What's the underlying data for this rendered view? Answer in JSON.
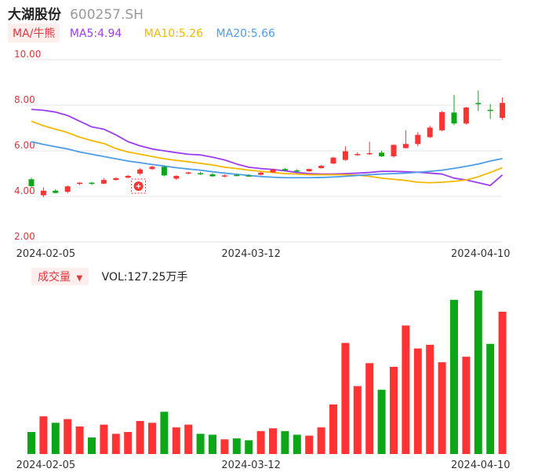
{
  "header": {
    "name": "大湖股份",
    "code": "600257.SH"
  },
  "ma_bar": {
    "button": "MA/牛熊",
    "items": [
      {
        "label": "MA5:4.94",
        "color": "#9b3ef2"
      },
      {
        "label": "MA10:5.26",
        "color": "#f5b800"
      },
      {
        "label": "MA20:5.66",
        "color": "#4d9de8"
      }
    ]
  },
  "vol_bar": {
    "button": "成交量",
    "value": "VOL:127.25万手"
  },
  "colors": {
    "up": "#ff3333",
    "down": "#0da619",
    "accent": "#e0353b"
  },
  "chart_data": {
    "type": "candlestick",
    "price_axis": {
      "ticks": [
        "10.00",
        "8.00",
        "6.00",
        "4.00",
        "2.00"
      ],
      "ylim": [
        2,
        10
      ]
    },
    "date_ticks": [
      {
        "label": "2024-02-05",
        "index": 1
      },
      {
        "label": "2024-03-12",
        "index": 18
      },
      {
        "label": "2024-04-10",
        "index": 37
      }
    ],
    "candles": [
      {
        "o": 4.75,
        "h": 4.82,
        "l": 4.42,
        "c": 4.45
      },
      {
        "o": 4.05,
        "h": 4.4,
        "l": 3.96,
        "c": 4.25
      },
      {
        "o": 4.25,
        "h": 4.32,
        "l": 4.14,
        "c": 4.15
      },
      {
        "o": 4.2,
        "h": 4.48,
        "l": 4.14,
        "c": 4.44
      },
      {
        "o": 4.55,
        "h": 4.62,
        "l": 4.5,
        "c": 4.6
      },
      {
        "o": 4.6,
        "h": 4.64,
        "l": 4.5,
        "c": 4.58
      },
      {
        "o": 4.56,
        "h": 4.8,
        "l": 4.54,
        "c": 4.72
      },
      {
        "o": 4.72,
        "h": 4.84,
        "l": 4.7,
        "c": 4.8
      },
      {
        "o": 4.82,
        "h": 4.94,
        "l": 4.8,
        "c": 4.9
      },
      {
        "o": 5.0,
        "h": 5.24,
        "l": 4.94,
        "c": 5.18
      },
      {
        "o": 5.2,
        "h": 5.35,
        "l": 5.16,
        "c": 5.3
      },
      {
        "o": 5.3,
        "h": 5.35,
        "l": 4.88,
        "c": 4.92
      },
      {
        "o": 4.78,
        "h": 4.92,
        "l": 4.72,
        "c": 4.9
      },
      {
        "o": 5.0,
        "h": 5.08,
        "l": 4.97,
        "c": 5.05
      },
      {
        "o": 5.02,
        "h": 5.08,
        "l": 4.94,
        "c": 4.97
      },
      {
        "o": 4.97,
        "h": 5.02,
        "l": 4.86,
        "c": 4.88
      },
      {
        "o": 4.88,
        "h": 4.96,
        "l": 4.84,
        "c": 4.92
      },
      {
        "o": 4.94,
        "h": 4.98,
        "l": 4.9,
        "c": 4.92
      },
      {
        "o": 4.92,
        "h": 4.97,
        "l": 4.86,
        "c": 4.9
      },
      {
        "o": 4.95,
        "h": 5.07,
        "l": 4.92,
        "c": 5.04
      },
      {
        "o": 5.06,
        "h": 5.22,
        "l": 5.03,
        "c": 5.18
      },
      {
        "o": 5.2,
        "h": 5.25,
        "l": 5.1,
        "c": 5.14
      },
      {
        "o": 5.14,
        "h": 5.2,
        "l": 5.06,
        "c": 5.12
      },
      {
        "o": 5.1,
        "h": 5.22,
        "l": 5.08,
        "c": 5.2
      },
      {
        "o": 5.24,
        "h": 5.38,
        "l": 5.22,
        "c": 5.34
      },
      {
        "o": 5.44,
        "h": 5.74,
        "l": 5.42,
        "c": 5.7
      },
      {
        "o": 5.6,
        "h": 6.2,
        "l": 5.56,
        "c": 5.98
      },
      {
        "o": 5.85,
        "h": 5.94,
        "l": 5.78,
        "c": 5.86
      },
      {
        "o": 5.86,
        "h": 6.4,
        "l": 5.82,
        "c": 5.9
      },
      {
        "o": 5.92,
        "h": 6.0,
        "l": 5.72,
        "c": 5.76
      },
      {
        "o": 5.76,
        "h": 6.28,
        "l": 5.7,
        "c": 6.26
      },
      {
        "o": 6.12,
        "h": 6.9,
        "l": 6.1,
        "c": 6.3
      },
      {
        "o": 6.3,
        "h": 6.82,
        "l": 6.2,
        "c": 6.7
      },
      {
        "o": 6.6,
        "h": 7.1,
        "l": 6.56,
        "c": 7.02
      },
      {
        "o": 6.9,
        "h": 7.75,
        "l": 6.85,
        "c": 7.7
      },
      {
        "o": 7.68,
        "h": 8.45,
        "l": 7.12,
        "c": 7.2
      },
      {
        "o": 7.2,
        "h": 7.93,
        "l": 7.15,
        "c": 7.9
      },
      {
        "o": 8.1,
        "h": 8.65,
        "l": 7.75,
        "c": 8.05
      },
      {
        "o": 7.8,
        "h": 8.05,
        "l": 7.4,
        "c": 7.75
      },
      {
        "o": 7.45,
        "h": 8.35,
        "l": 7.35,
        "c": 8.1
      }
    ],
    "ma5": [
      7.82,
      7.78,
      7.7,
      7.55,
      7.3,
      7.05,
      6.95,
      6.7,
      6.4,
      6.22,
      6.08,
      6.0,
      5.92,
      5.85,
      5.82,
      5.72,
      5.6,
      5.42,
      5.28,
      5.22,
      5.18,
      5.12,
      5.05,
      5.0,
      4.98,
      4.98,
      5.0,
      5.02,
      5.05,
      5.1,
      5.1,
      5.08,
      5.06,
      5.02,
      4.98,
      4.8,
      4.72,
      4.6,
      4.48,
      4.94
    ],
    "ma10": [
      7.3,
      7.1,
      6.95,
      6.8,
      6.6,
      6.45,
      6.32,
      6.1,
      5.95,
      5.85,
      5.75,
      5.65,
      5.58,
      5.52,
      5.45,
      5.38,
      5.28,
      5.22,
      5.15,
      5.1,
      5.05,
      5.0,
      4.98,
      4.95,
      4.95,
      4.95,
      4.95,
      4.93,
      4.88,
      4.8,
      4.75,
      4.7,
      4.62,
      4.6,
      4.62,
      4.66,
      4.72,
      4.86,
      5.05,
      5.26
    ],
    "ma20": [
      6.4,
      6.28,
      6.18,
      6.08,
      5.95,
      5.85,
      5.75,
      5.65,
      5.55,
      5.48,
      5.4,
      5.33,
      5.26,
      5.2,
      5.15,
      5.08,
      5.02,
      4.97,
      4.92,
      4.87,
      4.84,
      4.82,
      4.82,
      4.82,
      4.83,
      4.85,
      4.88,
      4.92,
      4.95,
      4.98,
      5.0,
      5.02,
      5.06,
      5.1,
      5.15,
      5.23,
      5.32,
      5.42,
      5.55,
      5.66
    ],
    "volume": [
      24,
      41,
      34,
      38,
      30,
      18,
      32,
      22,
      24,
      36,
      34,
      46,
      29,
      32,
      22,
      21,
      16,
      17,
      15,
      25,
      28,
      25,
      21,
      20,
      29,
      54,
      121,
      74,
      99,
      70,
      95,
      140,
      115,
      119,
      100,
      168,
      106,
      178,
      120,
      155
    ]
  }
}
